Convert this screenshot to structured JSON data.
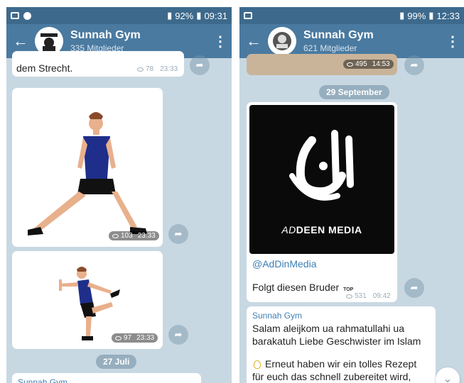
{
  "left": {
    "status": {
      "signal": "92%",
      "time": "09:31"
    },
    "header": {
      "title": "Sunnah Gym",
      "subtitle": "335 Mitglieder"
    },
    "msg1": {
      "text": "dem Strecht.",
      "views": "78",
      "time": "23:33"
    },
    "msg2": {
      "views": "103",
      "time": "23:33"
    },
    "msg3": {
      "views": "97",
      "time": "23:33"
    },
    "date": "27 Juli",
    "msg4": {
      "sender": "Sunnah Gym"
    }
  },
  "right": {
    "status": {
      "signal": "99%",
      "time": "12:33"
    },
    "header": {
      "title": "Sunnah Gym",
      "subtitle": "621 Mitglieder"
    },
    "msg1": {
      "views": "495",
      "time": "14:53"
    },
    "date": "29 September",
    "msg2": {
      "logo_text_a": "AD",
      "logo_text_b": "DEEN MEDIA",
      "link": "@AdDinMedia",
      "text": "Folgt diesen Bruder",
      "top_badge": "TOP",
      "views": "531",
      "time": "09:42"
    },
    "msg3": {
      "sender": "Sunnah Gym",
      "text1": "Salam aleijkom ua rahmatullahi ua",
      "text2": "barakatuh Liebe Geschwister im Islam",
      "text3": "Erneut haben wir ein tolles Rezept",
      "text4": "für euch das schnell zubereitet wird,"
    }
  },
  "icons": {
    "back": "arrow-left-icon",
    "menu": "more-vertical-icon",
    "share": "share-icon",
    "eye": "eye-icon",
    "scroll": "chevron-down-icon",
    "bulb": "lightbulb-icon"
  }
}
